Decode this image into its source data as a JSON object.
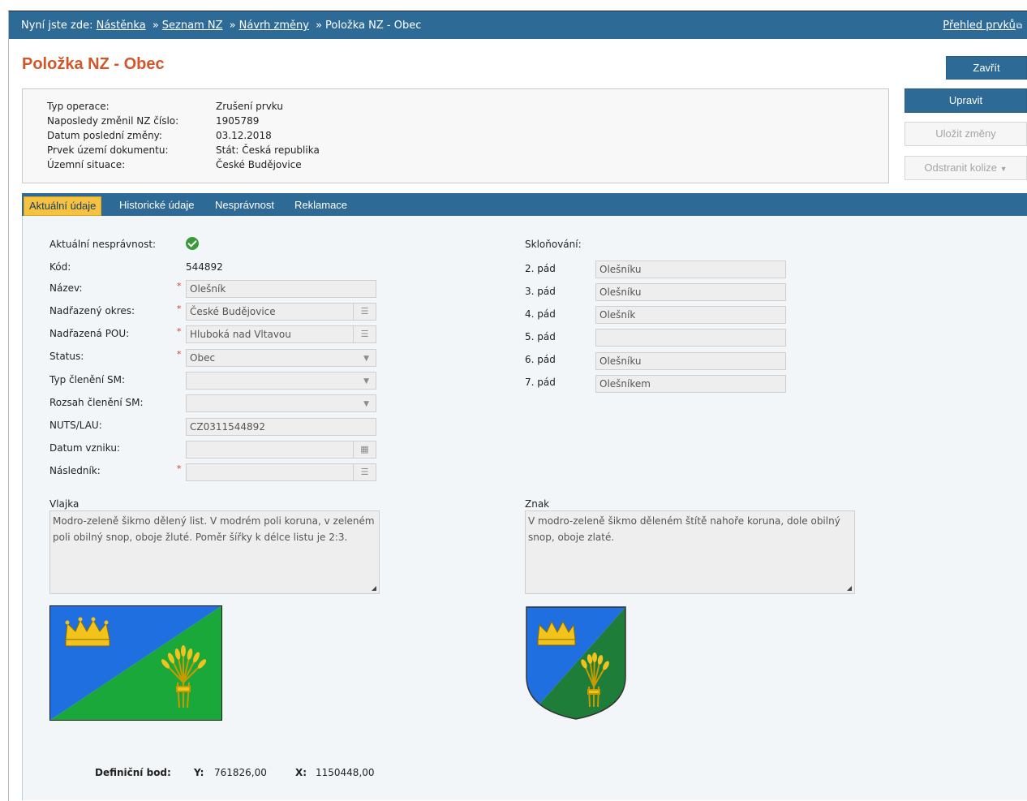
{
  "breadcrumb": {
    "prefix": "Nyní jste zde:",
    "items": [
      "Nástěnka",
      "Seznam NZ",
      "Návrh změny"
    ],
    "separator": "»",
    "current": "Položka NZ - Obec"
  },
  "overview_link": "Přehled prvků",
  "page_title": "Položka NZ - Obec",
  "info": [
    {
      "label": "Typ operace:",
      "value": "Zrušení prvku"
    },
    {
      "label": "Naposledy změnil NZ číslo:",
      "value": "1905789"
    },
    {
      "label": "Datum poslední změny:",
      "value": "03.12.2018"
    },
    {
      "label": "Prvek území dokumentu:",
      "value": "Stát: Česká republika"
    },
    {
      "label": "Územní situace:",
      "value": "České Budějovice"
    }
  ],
  "buttons": {
    "close": "Zavřít",
    "edit": "Upravit",
    "save": "Uložit změny",
    "remove_collision": "Odstranit kolize"
  },
  "tabs": [
    "Aktuální údaje",
    "Historické údaje",
    "Nesprávnost",
    "Reklamace"
  ],
  "form": {
    "incorrectness_label": "Aktuální nesprávnost:",
    "code_label": "Kód:",
    "code_value": "544892",
    "name_label": "Název:",
    "name_value": "Olešník",
    "district_label": "Nadřazený okres:",
    "district_value": "České Budějovice",
    "pou_label": "Nadřazená POU:",
    "pou_value": "Hluboká nad Vltavou",
    "status_label": "Status:",
    "status_value": "Obec",
    "sm_type_label": "Typ členění SM:",
    "sm_type_value": "",
    "sm_range_label": "Rozsah členění SM:",
    "sm_range_value": "",
    "nuts_label": "NUTS/LAU:",
    "nuts_value": "CZ0311544892",
    "date_label": "Datum vzniku:",
    "date_value": "",
    "successor_label": "Následník:",
    "successor_value": "",
    "flag_label": "Vlajka",
    "flag_text": "Modro-zeleně šikmo dělený list. V modrém poli koruna, v zeleném poli obilný snop, oboje žluté. Poměr šířky k délce listu je 2:3.",
    "emblem_label": "Znak",
    "emblem_text": "V modro-zeleně šikmo děleném štítě nahoře koruna, dole obilný snop, oboje zlaté."
  },
  "declension": {
    "title": "Skloňování:",
    "cases": [
      {
        "label": "2. pád",
        "value": "Olešníku"
      },
      {
        "label": "3. pád",
        "value": "Olešníku"
      },
      {
        "label": "4. pád",
        "value": "Olešník"
      },
      {
        "label": "5. pád",
        "value": ""
      },
      {
        "label": "6. pád",
        "value": "Olešníku"
      },
      {
        "label": "7. pád",
        "value": "Olešníkem"
      }
    ]
  },
  "definition_point": {
    "label": "Definiční bod:",
    "y_label": "Y:",
    "y_value": "761826,00",
    "x_label": "X:",
    "x_value": "1150448,00"
  },
  "colors": {
    "header": "#2e6a96",
    "title": "#d0572a",
    "tab_active": "#f5c242",
    "flag_blue": "#1f6fe0",
    "flag_green": "#1aa83a",
    "gold": "#f2c31b"
  }
}
